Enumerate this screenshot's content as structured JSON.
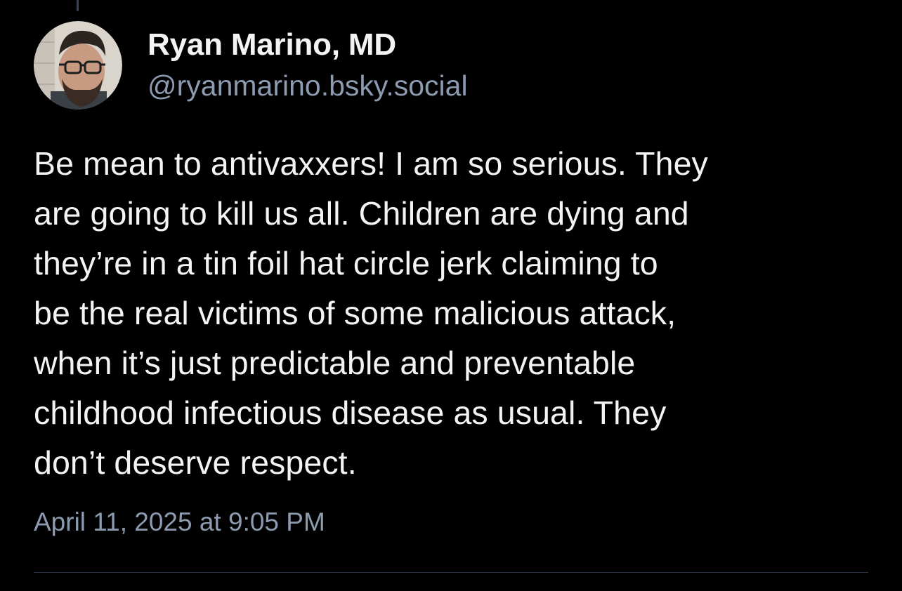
{
  "theme": {
    "background": "#000000",
    "text_primary": "#f1f3f5",
    "text_secondary": "#8d9bb0",
    "divider": "#2e3845"
  },
  "post": {
    "author": {
      "display_name": "Ryan Marino, MD",
      "handle": "@ryanmarino.bsky.social",
      "avatar_icon": "user-avatar-photo"
    },
    "text_lines": [
      "Be mean to antivaxxers! I am so serious. They",
      "are going to kill us all. Children are dying and",
      "they’re in a tin foil hat circle jerk claiming to",
      "be the real victims of some malicious attack,",
      "when it’s just predictable and preventable",
      "childhood infectious disease as usual. They",
      "don’t deserve respect."
    ],
    "timestamp": "April 11, 2025 at 9:05 PM"
  }
}
